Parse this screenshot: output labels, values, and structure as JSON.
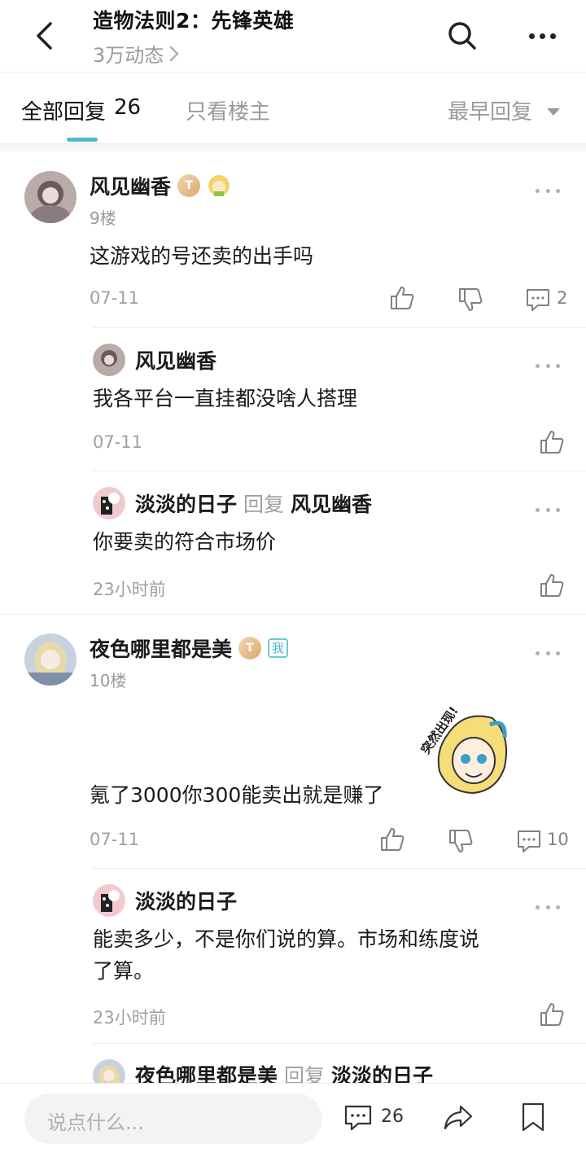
{
  "header": {
    "title": "造物法则2：先锋英雄",
    "subtitle": "3万动态"
  },
  "tabs": {
    "all_label": "全部回复",
    "all_count": "26",
    "owner_only": "只看楼主",
    "sort": "最早回复"
  },
  "floors": [
    {
      "name": "风见幽香",
      "floor": "9楼",
      "content": "这游戏的号还卖的出手吗",
      "time": "07-11",
      "comment_count": "2",
      "replies": [
        {
          "name": "风见幽香",
          "content": "我各平台一直挂都没啥人搭理",
          "time": "07-11"
        },
        {
          "name": "淡淡的日子",
          "reply_word": "回复",
          "reply_to": "风见幽香",
          "content": "你要卖的符合市场价",
          "time": "23小时前"
        }
      ]
    },
    {
      "name": "夜色哪里都是美",
      "badge_me": "我",
      "floor": "10楼",
      "sticker_text": "突然出现!",
      "content": "氪了3000你300能卖出就是赚了",
      "time": "07-11",
      "comment_count": "10",
      "replies": [
        {
          "name": "淡淡的日子",
          "content_line1": "能卖多少，不是你们说的算。市场和练度说",
          "content_line2": "了算。",
          "time": "23小时前"
        },
        {
          "name": "夜色哪里都是美",
          "reply_word": "回复",
          "reply_to": "淡淡的日子"
        }
      ]
    }
  ],
  "bottom": {
    "placeholder": "说点什么...",
    "comment_count": "26"
  }
}
